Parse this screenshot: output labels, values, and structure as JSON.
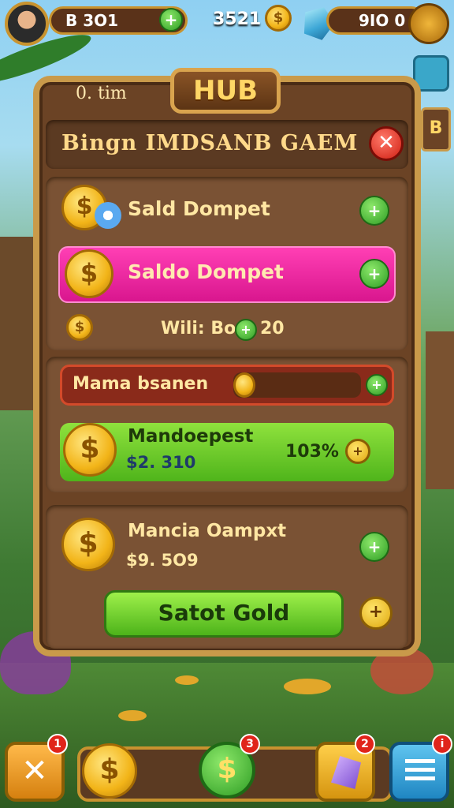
{
  "top_bar": {
    "currency_left": "B 3O1",
    "plus_left": "+",
    "center_value": "3521",
    "currency_right": "9IO 0",
    "coin_symbol": "$"
  },
  "side_icons": {
    "book_label": "B"
  },
  "panel": {
    "hub_label": "HUB",
    "corner_label": "0. tim",
    "title": "Bingn IMDSANB GAEM",
    "close_symbol": "✕"
  },
  "rows": {
    "wallet1_label": "Sald Dompet",
    "wallet2_label": "Saldo Dompet",
    "will_text": "Wili: Bo",
    "will_value": "20",
    "mama_label": "Mama bsanen",
    "mandoepest_label": "Mandoepest",
    "mandoepest_value": "$2. 310",
    "mandoepest_percent": "103%",
    "mancia_label": "Mancia Oampxt",
    "mancia_value": "$9. 5O9",
    "gold_button": "Satot Gold",
    "plus_symbol": "+"
  },
  "bottom_bar": {
    "badge_1": "1",
    "badge_2": "3",
    "badge_3": "2",
    "badge_4": "i",
    "coin_symbol": "$"
  },
  "colors": {
    "panel_wood": "#6b4325",
    "frame_gold": "#c99a4a",
    "accent_pink": "#e0209c",
    "accent_green": "#5cc21f",
    "accent_red": "#d01e12"
  }
}
